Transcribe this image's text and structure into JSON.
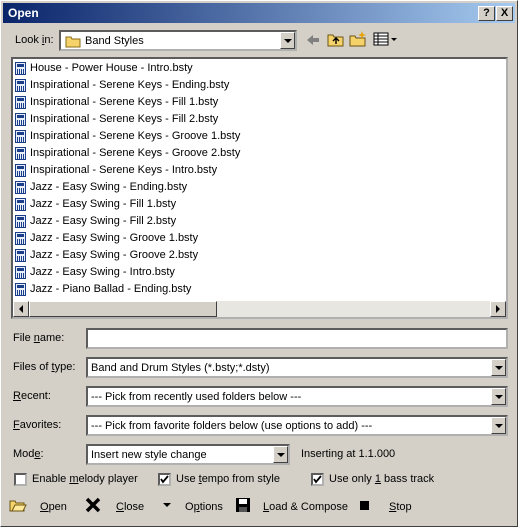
{
  "window": {
    "title": "Open"
  },
  "titlebar_buttons": {
    "help": "?",
    "close": "X"
  },
  "look_in": {
    "label": "Look in:",
    "value": "Band Styles"
  },
  "files": [
    "House - Power House - Intro.bsty",
    "Inspirational - Serene Keys - Ending.bsty",
    "Inspirational - Serene Keys - Fill 1.bsty",
    "Inspirational - Serene Keys - Fill 2.bsty",
    "Inspirational - Serene Keys - Groove 1.bsty",
    "Inspirational - Serene Keys - Groove 2.bsty",
    "Inspirational - Serene Keys - Intro.bsty",
    "Jazz - Easy Swing - Ending.bsty",
    "Jazz - Easy Swing - Fill 1.bsty",
    "Jazz - Easy Swing - Fill 2.bsty",
    "Jazz - Easy Swing - Groove 1.bsty",
    "Jazz - Easy Swing - Groove 2.bsty",
    "Jazz - Easy Swing - Intro.bsty",
    "Jazz - Piano Ballad - Ending.bsty"
  ],
  "file_name": {
    "label": "File name:",
    "value": ""
  },
  "files_of_type": {
    "label": "Files of type:",
    "value": "Band and Drum Styles (*.bsty;*.dsty)"
  },
  "recent": {
    "label": "Recent:",
    "value": "--- Pick from recently used folders below ---"
  },
  "favorites": {
    "label": "Favorites:",
    "value": "--- Pick from favorite folders below (use options to add) ---"
  },
  "mode": {
    "label": "Mode:",
    "value": "Insert new style change",
    "status": "Inserting at 1.1.000"
  },
  "checkboxes": {
    "melody": {
      "label": "Enable melody player",
      "checked": false
    },
    "tempo": {
      "label": "Use tempo from style",
      "checked": true
    },
    "bass": {
      "label": "Use only 1 bass track",
      "checked": true
    }
  },
  "buttons": {
    "open": "Open",
    "close": "Close",
    "options": "Options",
    "load_compose": "Load & Compose",
    "stop": "Stop"
  }
}
